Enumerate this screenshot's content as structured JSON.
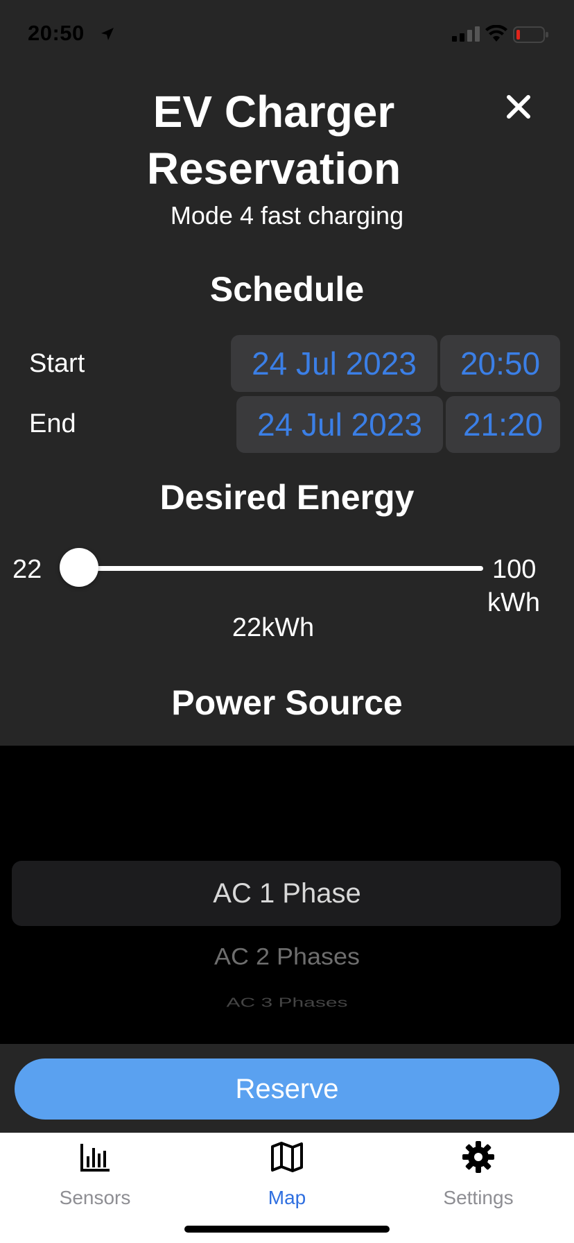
{
  "status_bar": {
    "time": "20:50"
  },
  "header": {
    "title_line1": "EV Charger",
    "title_line2": "Reservation",
    "subtitle": "Mode 4 fast charging"
  },
  "schedule": {
    "heading": "Schedule",
    "start": {
      "label": "Start",
      "date": "24 Jul 2023",
      "time": "20:50"
    },
    "end": {
      "label": "End",
      "date": "24 Jul 2023",
      "time": "21:20"
    }
  },
  "energy": {
    "heading": "Desired Energy",
    "min": "22",
    "max": "100",
    "unit": "kWh",
    "value_label": "22kWh",
    "value": 22
  },
  "power_source": {
    "heading": "Power Source",
    "options": [
      "AC 1 Phase",
      "AC 2 Phases",
      "AC 3 Phases"
    ],
    "selected": "AC 1 Phase"
  },
  "reserve_label": "Reserve",
  "tabs": [
    {
      "label": "Sensors",
      "icon": "bar-chart-icon",
      "active": false
    },
    {
      "label": "Map",
      "icon": "map-icon",
      "active": true
    },
    {
      "label": "Settings",
      "icon": "gear-icon",
      "active": false
    }
  ],
  "colors": {
    "accent": "#3b7fe6",
    "reserve_button": "#5aa1f0",
    "sheet_background": "#262626",
    "tab_inactive": "#8e8e93",
    "tab_active": "#2f6fe0"
  }
}
